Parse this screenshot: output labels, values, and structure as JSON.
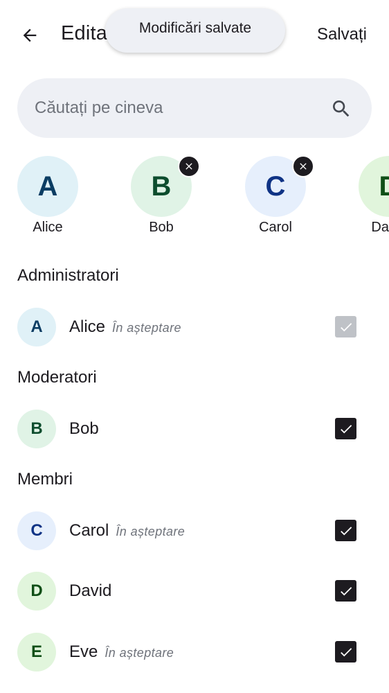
{
  "header": {
    "title": "Editați",
    "save_label": "Salvați"
  },
  "toast": {
    "message": "Modificări salvate"
  },
  "search": {
    "placeholder": "Căutați pe cineva"
  },
  "selected_chips": [
    {
      "initial": "A",
      "name": "Alice",
      "removable": false,
      "bg": "#e0f1f7",
      "fg": "#0b3d63"
    },
    {
      "initial": "B",
      "name": "Bob",
      "removable": true,
      "bg": "#e0f3e6",
      "fg": "#0d4d2e"
    },
    {
      "initial": "C",
      "name": "Carol",
      "removable": true,
      "bg": "#e6effc",
      "fg": "#0f3385"
    },
    {
      "initial": "D",
      "name": "David",
      "removable": false,
      "bg": "#e1f5dc",
      "fg": "#104f17"
    }
  ],
  "sections": {
    "admins": "Administratori",
    "moderators": "Moderatori",
    "members": "Membri"
  },
  "pending_label": "În așteptare",
  "members": [
    {
      "initial": "A",
      "name": "Alice",
      "pending": true,
      "checked": true,
      "disabled": true
    },
    {
      "initial": "B",
      "name": "Bob",
      "pending": false,
      "checked": true,
      "disabled": false
    },
    {
      "initial": "C",
      "name": "Carol",
      "pending": true,
      "checked": true,
      "disabled": false
    },
    {
      "initial": "D",
      "name": "David",
      "pending": false,
      "checked": true,
      "disabled": false
    },
    {
      "initial": "E",
      "name": "Eve",
      "pending": true,
      "checked": true,
      "disabled": false
    }
  ],
  "colors": {
    "checkbox_checked": "#1d1b20",
    "checkbox_disabled": "#bfc2c7",
    "search_bg": "#eef0f5",
    "avatar_e_bg": "#e1f5dc",
    "avatar_e_fg": "#104f17"
  },
  "icons": {
    "back": "arrow-left-icon",
    "search": "search-icon",
    "remove": "close-icon",
    "checkbox": "check-icon"
  }
}
